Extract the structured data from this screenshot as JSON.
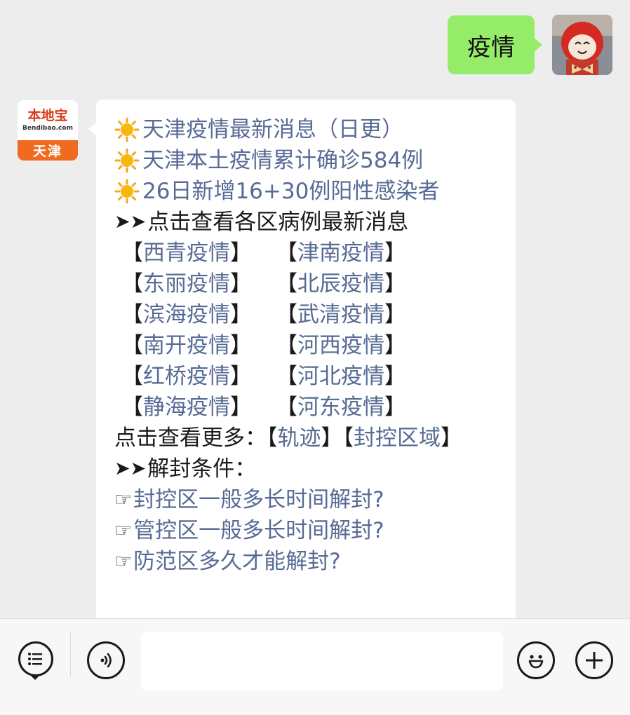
{
  "user_message": {
    "text": "疫情"
  },
  "bot": {
    "logo_cn": "本地宝",
    "logo_en": "Bendibao.com",
    "logo_city": "天津"
  },
  "reply": {
    "headlines": [
      "天津疫情最新消息（日更）",
      "天津本土疫情累计确诊584例",
      "26日新增16+30例阳性感染者"
    ],
    "districts_heading": "点击查看各区病例最新消息",
    "districts": [
      [
        "西青疫情",
        "津南疫情"
      ],
      [
        "东丽疫情",
        "北辰疫情"
      ],
      [
        "滨海疫情",
        "武清疫情"
      ],
      [
        "南开疫情",
        "河西疫情"
      ],
      [
        "红桥疫情",
        "河北疫情"
      ],
      [
        "静海疫情",
        "河东疫情"
      ]
    ],
    "more_label": "点击查看更多：",
    "more_links": [
      "轨迹",
      "封控区域"
    ],
    "unseal_heading": "解封条件：",
    "unseal_questions": [
      "封控区一般多长时间解封?",
      "管控区一般多长时间解封?",
      "防范区多久才能解封?"
    ]
  },
  "toolbar": {
    "icons": [
      "menu-list-icon",
      "voice-icon",
      "emoji-icon",
      "add-icon"
    ],
    "input_value": ""
  },
  "colors": {
    "user_bubble": "#95ec69",
    "link": "#576b95",
    "background": "#ededed",
    "logo_orange": "#ee6b1f",
    "logo_red": "#d93b17"
  }
}
